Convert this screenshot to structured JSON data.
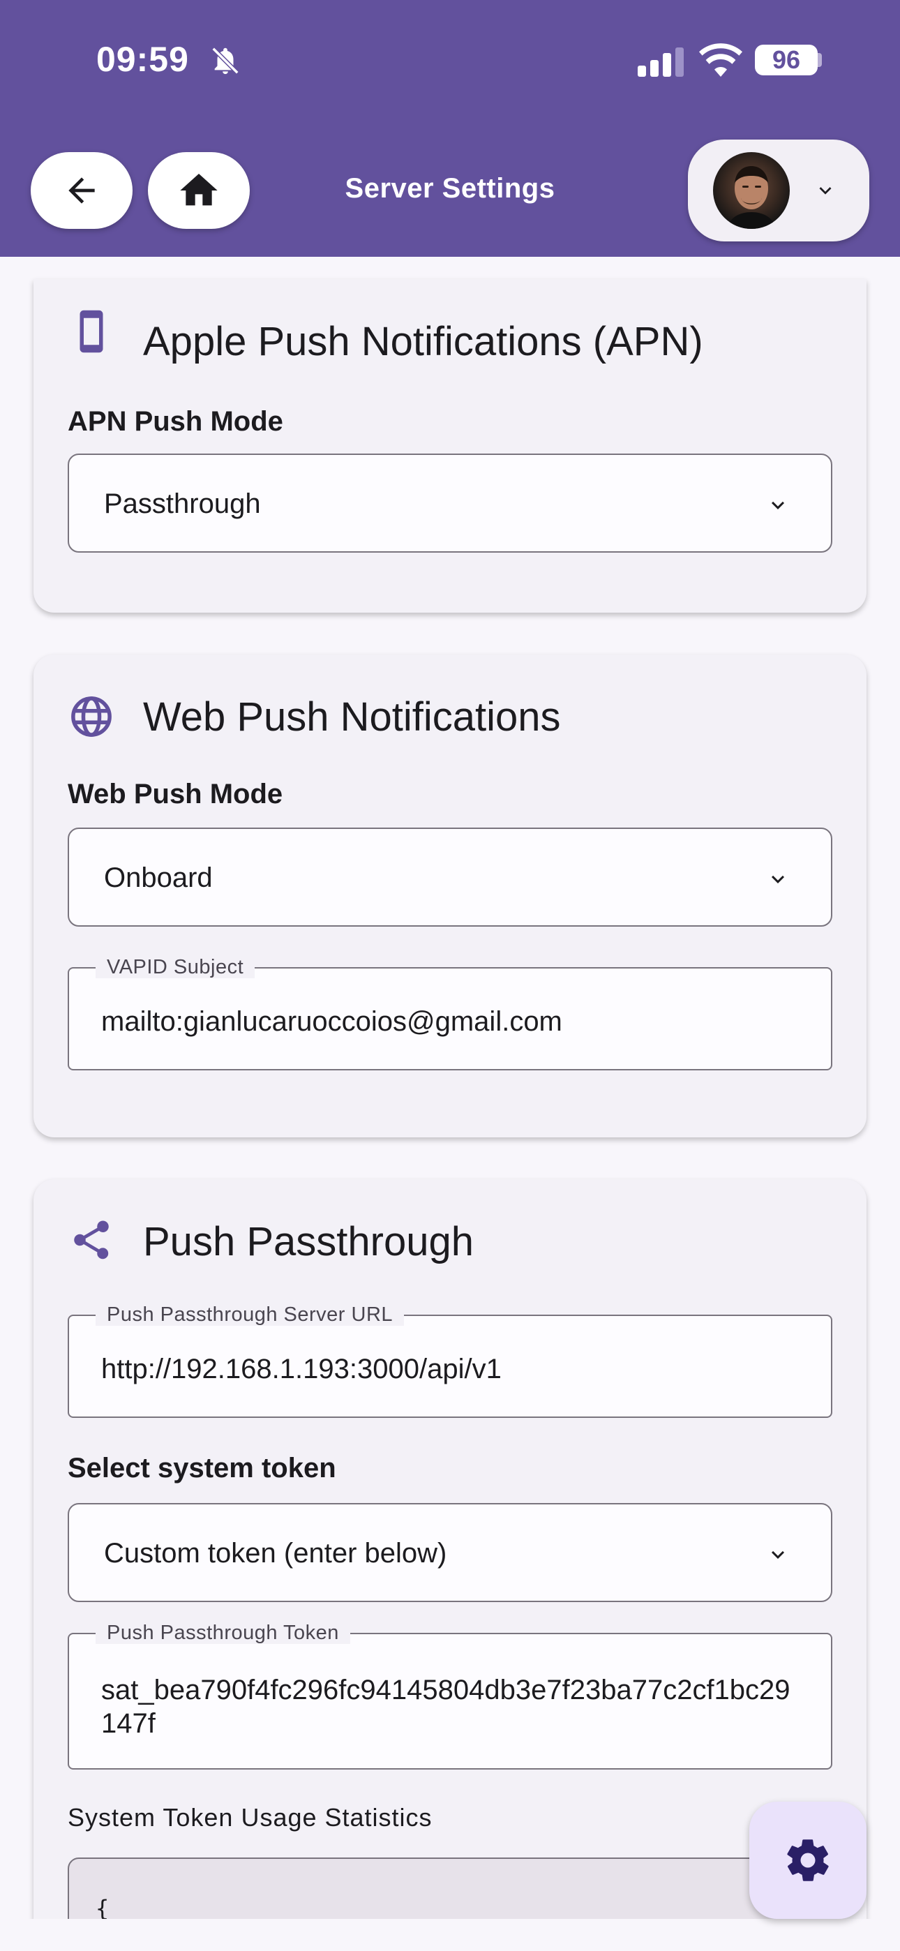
{
  "status_bar": {
    "time": "09:59",
    "battery": "96"
  },
  "header": {
    "title": "Server Settings",
    "back_icon": "arrow-left-icon",
    "home_icon": "home-icon",
    "account_chevron_icon": "chevron-down-icon"
  },
  "apn_section": {
    "title": "Apple Push Notifications (APN)",
    "icon": "smartphone-icon",
    "mode_label": "APN Push Mode",
    "mode_value": "Passthrough"
  },
  "web_push_section": {
    "title": "Web Push Notifications",
    "icon": "globe-icon",
    "mode_label": "Web Push Mode",
    "mode_value": "Onboard",
    "vapid_label": "VAPID Subject",
    "vapid_value": "mailto:gianlucaruoccoios@gmail.com"
  },
  "passthrough_section": {
    "title": "Push Passthrough",
    "icon": "share-icon",
    "server_url_label": "Push Passthrough Server URL",
    "server_url_value": "http://192.168.1.193:3000/api/v1",
    "token_select_label": "Select system token",
    "token_select_value": "Custom token (enter below)",
    "token_label": "Push Passthrough Token",
    "token_value": "sat_bea790f4fc296fc94145804db3e7f23ba77c2cf1bc29147f",
    "stats_label": "System Token Usage Statistics",
    "stats_value": "{"
  },
  "fab": {
    "icon": "gear-icon"
  },
  "colors": {
    "primary": "#62519d",
    "surface": "#f3f1f7",
    "fab": "#eae2fb"
  }
}
